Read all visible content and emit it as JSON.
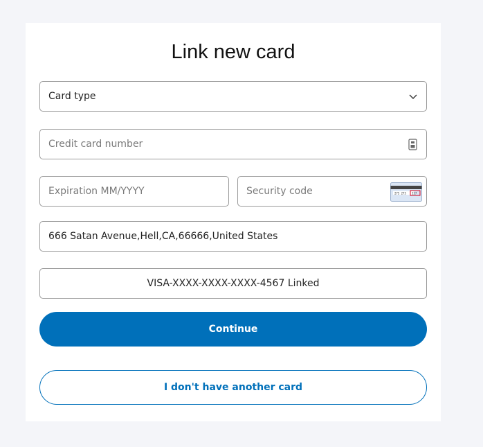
{
  "form": {
    "title": "Link new card",
    "card_type": {
      "value": "Card type"
    },
    "card_number": {
      "placeholder": "Credit card number"
    },
    "expiration": {
      "placeholder": "Expiration MM/YYYY"
    },
    "security_code": {
      "placeholder": "Security code"
    },
    "address": {
      "value": "666 Satan Avenue,Hell,CA,66666,United States"
    },
    "linked_card": {
      "value": "VISA-XXXX-XXXX-XXXX-4567 Linked"
    },
    "continue_label": "Continue",
    "no_card_label": "I don't have another card"
  },
  "colors": {
    "page_background": "#f4f5f9",
    "panel_background": "#ffffff",
    "primary": "#0070ba",
    "border": "#9a9a9a"
  },
  "icons": {
    "card_type_dropdown": "chevron-down-icon",
    "card_number": "card-number-icon",
    "security_code": "cvv-card-icon"
  }
}
